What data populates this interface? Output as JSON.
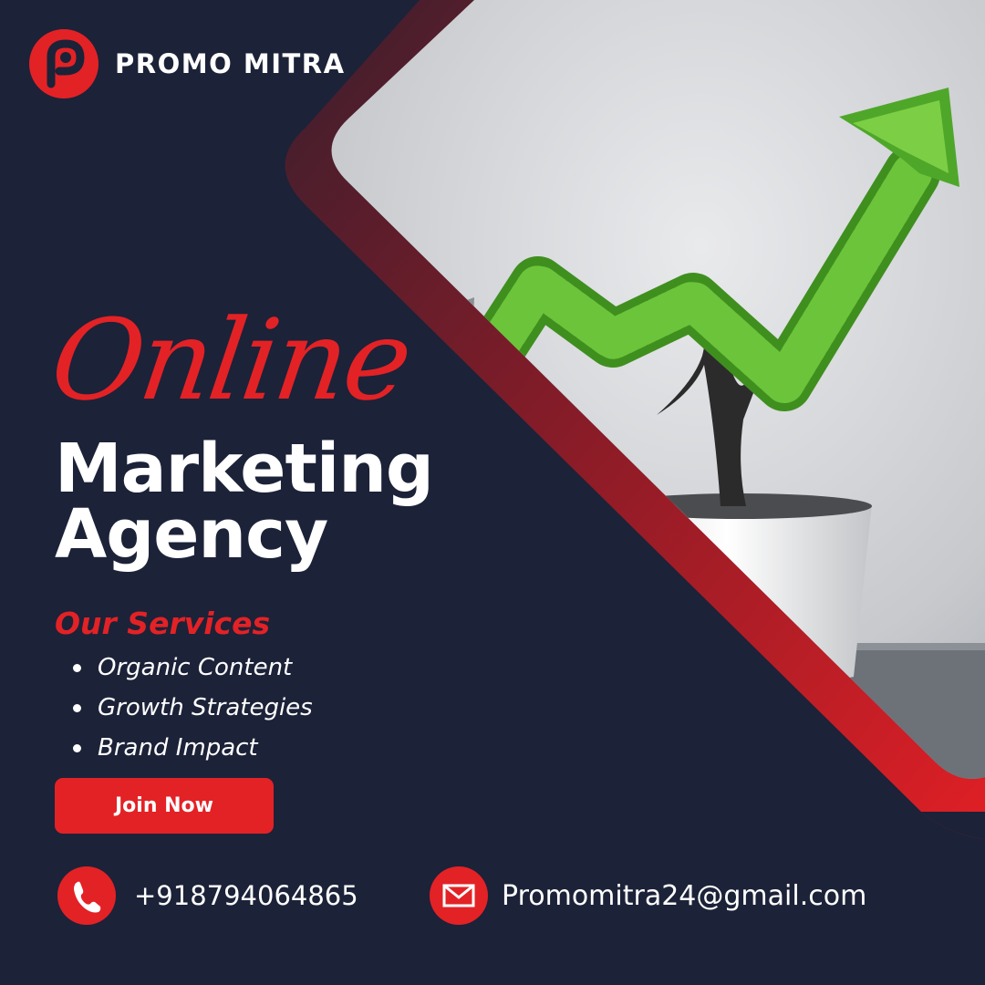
{
  "brand": {
    "name": "PROMO MITRA",
    "logo_icon": "p-logo-icon"
  },
  "headline": {
    "script": "Online",
    "line1": "Marketing",
    "line2": "Agency"
  },
  "services": {
    "title": "Our Services",
    "items": [
      "Organic Content",
      "Growth Strategies",
      "Brand Impact"
    ]
  },
  "cta": {
    "label": "Join Now"
  },
  "contact": {
    "phone": "+918794064865",
    "email": "Promomitra24@gmail.com",
    "phone_icon": "phone-icon",
    "email_icon": "mail-icon"
  },
  "colors": {
    "background": "#1c2238",
    "accent": "#e32226",
    "text": "#ffffff"
  }
}
